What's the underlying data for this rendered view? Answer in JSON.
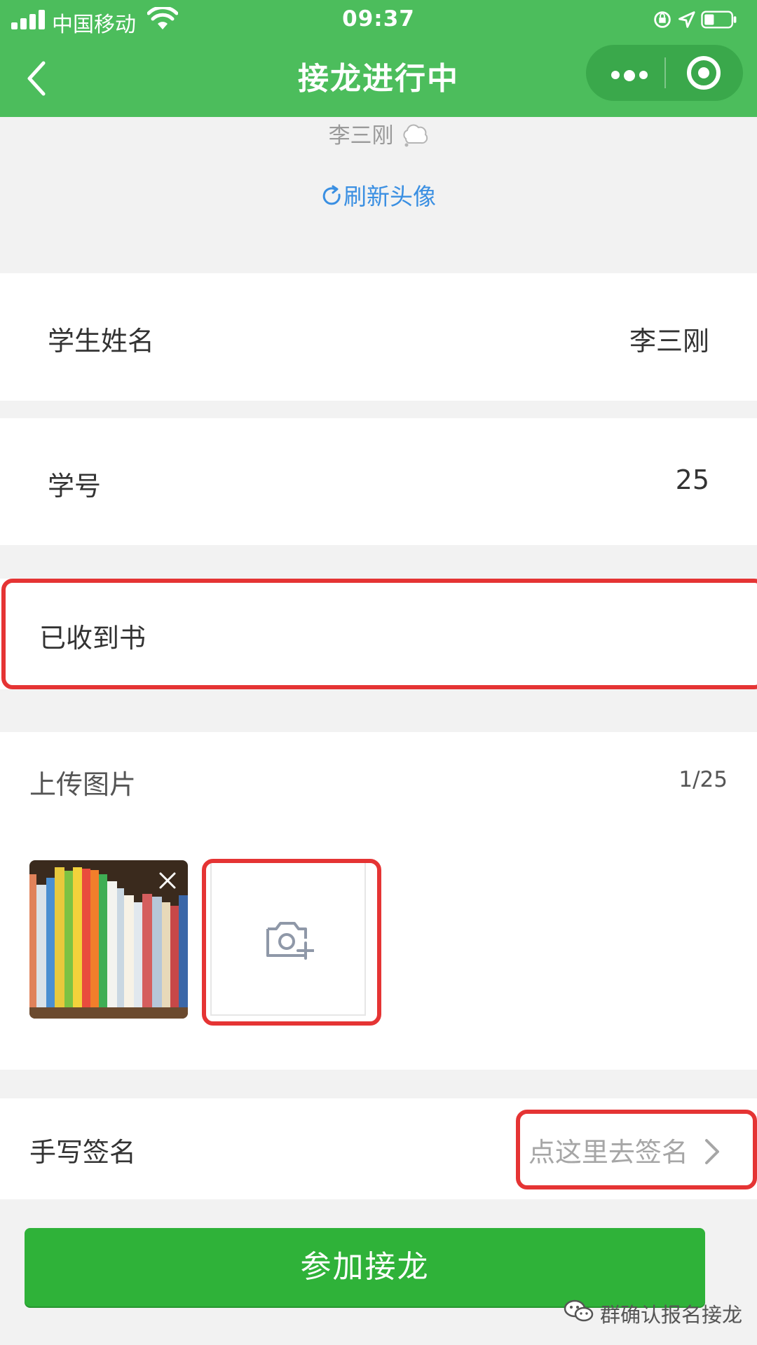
{
  "status_bar": {
    "carrier": "中国移动",
    "time": "09:37"
  },
  "nav": {
    "title": "接龙进行中"
  },
  "profile": {
    "name": "李三刚",
    "refresh_label": "刷新头像"
  },
  "form": {
    "student_name": {
      "label": "学生姓名",
      "value": "李三刚"
    },
    "student_id": {
      "label": "学号",
      "value": "25"
    },
    "received_note": {
      "text": "已收到书"
    },
    "upload": {
      "label": "上传图片",
      "count": "1/25"
    },
    "signature": {
      "label": "手写签名",
      "action": "点这里去签名"
    }
  },
  "submit": {
    "label": "参加接龙"
  },
  "watermark": {
    "text": "群确认报名接龙"
  },
  "colors": {
    "header_green": "#4cbd5c",
    "button_green": "#2fb239",
    "link_blue": "#3a8fe2",
    "highlight_red": "#e53434"
  },
  "icons": [
    "signal-icon",
    "wifi-icon",
    "lock-rotation-icon",
    "location-arrow-icon",
    "battery-icon",
    "back-arrow-icon",
    "more-dots-icon",
    "target-close-icon",
    "refresh-icon",
    "remove-x-icon",
    "camera-plus-icon",
    "chevron-right-icon",
    "wechat-icon"
  ]
}
